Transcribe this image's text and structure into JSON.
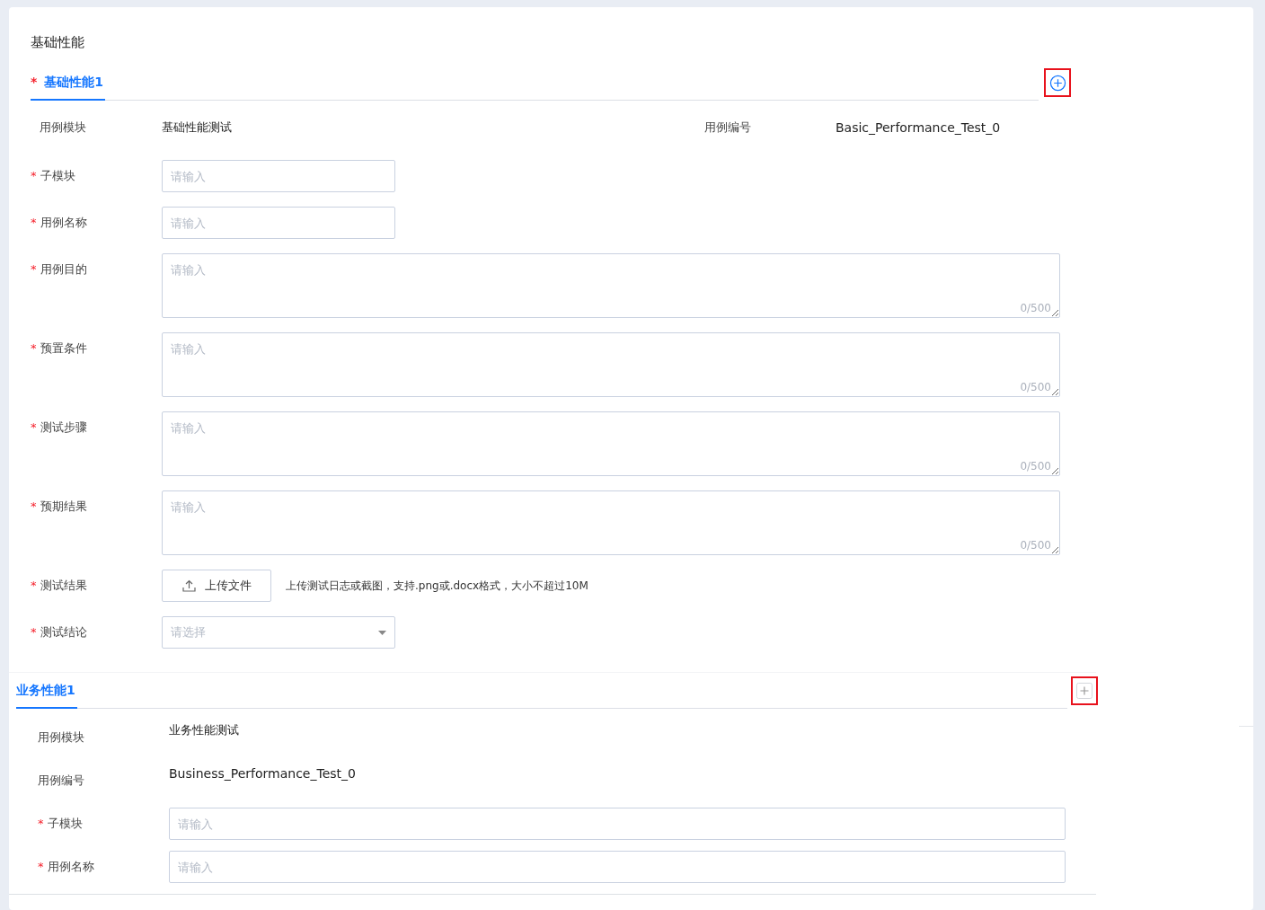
{
  "title": "基础性能",
  "required_mark": "*",
  "sections": [
    {
      "tab": {
        "label": "基础性能1",
        "required": true,
        "selected": true
      },
      "add_button": {
        "kind": "circle"
      },
      "info_inline": true,
      "info": [
        {
          "label": "用例模块",
          "value": "基础性能测试"
        },
        {
          "label": "用例编号",
          "value": "Basic_Performance_Test_0"
        }
      ],
      "fields": [
        {
          "kind": "input",
          "label": "子模块",
          "required": true,
          "placeholder": "请输入"
        },
        {
          "kind": "input",
          "label": "用例名称",
          "required": true,
          "placeholder": "请输入"
        },
        {
          "kind": "textarea",
          "label": "用例目的",
          "required": true,
          "placeholder": "请输入",
          "counter": "0/500"
        },
        {
          "kind": "textarea",
          "label": "预置条件",
          "required": true,
          "placeholder": "请输入",
          "counter": "0/500"
        },
        {
          "kind": "textarea",
          "label": "测试步骤",
          "required": true,
          "placeholder": "请输入",
          "counter": "0/500"
        },
        {
          "kind": "textarea",
          "label": "预期结果",
          "required": true,
          "placeholder": "请输入",
          "counter": "0/500"
        },
        {
          "kind": "upload",
          "label": "测试结果",
          "required": true,
          "button": "上传文件",
          "hint": "上传测试日志或截图，支持.png或.docx格式，大小不超过10M"
        },
        {
          "kind": "select",
          "label": "测试结论",
          "required": true,
          "placeholder": "请选择"
        }
      ]
    },
    {
      "tab": {
        "label": "业务性能1",
        "required": false,
        "selected": true
      },
      "add_button": {
        "kind": "square"
      },
      "info_inline": false,
      "info": [
        {
          "label": "用例模块",
          "value": "业务性能测试"
        },
        {
          "label": "用例编号",
          "value": "Business_Performance_Test_0"
        }
      ],
      "fields": [
        {
          "kind": "input",
          "label": "子模块",
          "required": true,
          "placeholder": "请输入"
        },
        {
          "kind": "input",
          "label": "用例名称",
          "required": true,
          "placeholder": "请输入"
        }
      ]
    }
  ]
}
